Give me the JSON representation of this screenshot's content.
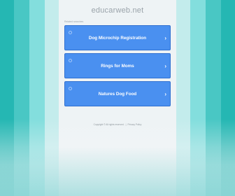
{
  "site": {
    "title": "educarweb.net"
  },
  "related_label": "Related searches",
  "links": [
    {
      "label": "Dog Microchip Registration",
      "chevron": "›"
    },
    {
      "label": "Rings for Moms",
      "chevron": "›"
    },
    {
      "label": "Natures Dog Food",
      "chevron": "›"
    }
  ],
  "footer": {
    "copyright": "Copyright © All rights reserved.",
    "separator": "|",
    "privacy": "Privacy Policy"
  },
  "colors": {
    "button": "#4a90f0",
    "button_border": "#2f6fd0",
    "stripe_dark": "#25b7b3",
    "stripe_mid": "#49c7c4",
    "stripe_light": "#83dedd",
    "stripe_pale": "#c3ecec"
  },
  "icons": {
    "link_icon": "search-icon",
    "link_arrow": "chevron-right-icon"
  }
}
